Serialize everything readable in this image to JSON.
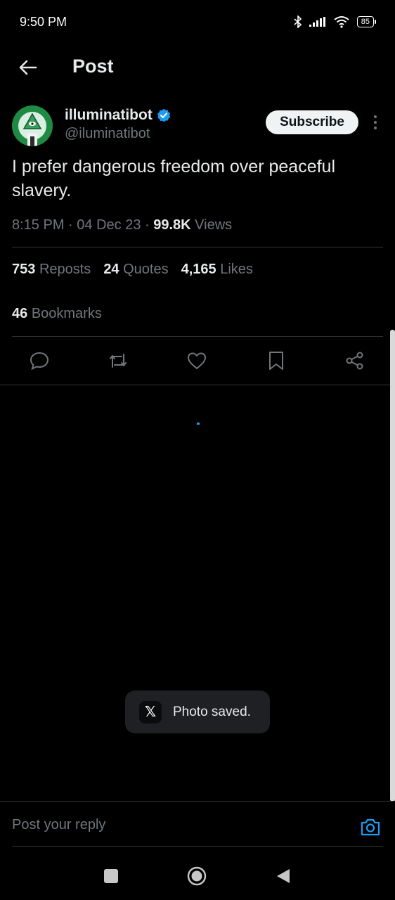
{
  "status_bar": {
    "time": "9:50 PM",
    "battery": "85"
  },
  "header": {
    "title": "Post"
  },
  "author": {
    "name": "illuminatibot",
    "handle": "@iluminatibot"
  },
  "subscribe_label": "Subscribe",
  "tweet": {
    "text": "I prefer dangerous freedom over peaceful slavery.",
    "time": "8:15 PM",
    "date": "04 Dec 23",
    "views_count": "99.8K",
    "views_label": "Views"
  },
  "stats": {
    "reposts_count": "753",
    "reposts_label": "Reposts",
    "quotes_count": "24",
    "quotes_label": "Quotes",
    "likes_count": "4,165",
    "likes_label": "Likes",
    "bookmarks_count": "46",
    "bookmarks_label": "Bookmarks"
  },
  "toast": {
    "logo": "𝕏",
    "text": "Photo saved."
  },
  "reply": {
    "placeholder": "Post your reply"
  },
  "colors": {
    "accent": "#1d9bf0",
    "background": "#000000",
    "muted": "#71767b"
  },
  "icons": [
    "back-arrow-icon",
    "verified-badge-icon",
    "more-icon",
    "reply-icon",
    "repost-icon",
    "like-icon",
    "bookmark-icon",
    "share-icon",
    "camera-icon"
  ]
}
